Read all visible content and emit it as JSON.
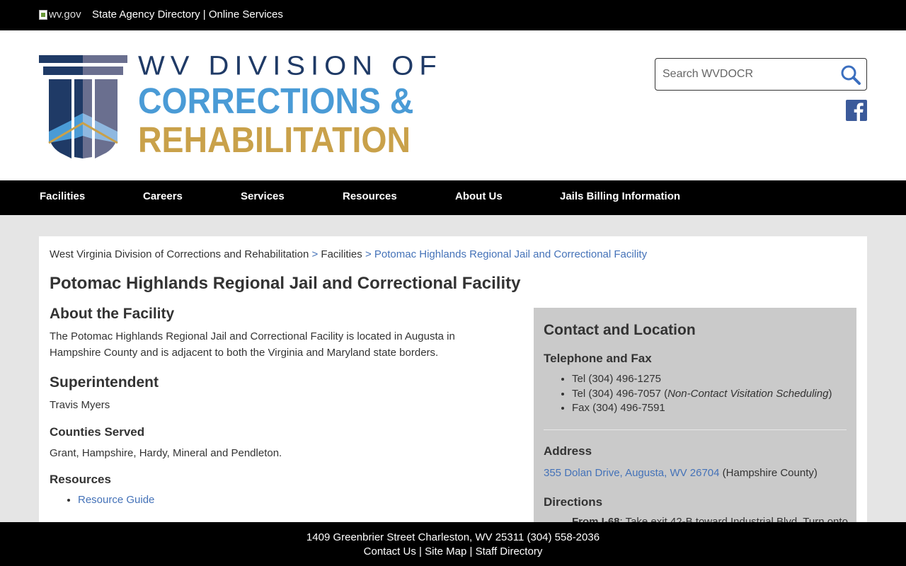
{
  "topbar": {
    "logo_alt": "wv.gov",
    "link_directory": "State Agency Directory",
    "separator": "|",
    "link_services": "Online Services"
  },
  "header": {
    "logo_line1": "WV DIVISION OF",
    "logo_line2": "CORRECTIONS &",
    "logo_line3": "REHABILITATION",
    "search_placeholder": "Search WVDOCR",
    "search_icon": "search-icon",
    "social_icon": "facebook-icon"
  },
  "nav": {
    "items": [
      {
        "label": "Facilities"
      },
      {
        "label": "Careers"
      },
      {
        "label": "Services"
      },
      {
        "label": "Resources"
      },
      {
        "label": "About Us"
      },
      {
        "label": "Jails Billing Information"
      }
    ]
  },
  "breadcrumb": {
    "home": "West Virginia Division of Corrections and Rehabilitation",
    "sep": ">",
    "section": "Facilities",
    "current": "Potomac Highlands Regional Jail and Correctional Facility"
  },
  "page": {
    "title": "Potomac Highlands Regional Jail and Correctional Facility",
    "about_heading": "About the Facility",
    "about_text": "The Potomac Highlands Regional Jail and Correctional Facility is located in Augusta in Hampshire County and is adjacent to both the Virginia and Maryland state borders.",
    "superintendent_heading": "Superintendent",
    "superintendent_name": "Travis Myers",
    "counties_heading": "Counties Served",
    "counties_text": "Grant, Hampshire, Hardy, Mineral and Pendleton.",
    "resources_heading": "Resources",
    "resources_links": [
      "Resource Guide"
    ]
  },
  "contact": {
    "heading": "Contact and Location",
    "phone_heading": "Telephone and Fax",
    "tel1": "Tel (304) 496-1275",
    "tel2_prefix": "Tel (304) 496-7057 (",
    "tel2_note": "Non-Contact Visitation Scheduling",
    "tel2_suffix": ")",
    "fax": "Fax (304) 496-7591",
    "address_heading": "Address",
    "address_link": "355 Dolan Drive, Augusta, WV 26704",
    "address_county": "(Hampshire County)",
    "directions_heading": "Directions",
    "directions_lead": "From I-68",
    "directions_text": ": Take exit 42-B toward Industrial Blvd. Turn onto"
  },
  "footer": {
    "address": "1409 Greenbrier Street Charleston, WV 25311 (304) 558-2036",
    "links": [
      "Contact Us",
      "Site Map",
      "Staff Directory"
    ],
    "sep": "|"
  },
  "colors": {
    "link": "#4472b8",
    "logo_navy": "#1f3a66",
    "logo_blue": "#4a9bd6",
    "logo_gold": "#c9a14a",
    "contact_bg": "#cacaca"
  }
}
